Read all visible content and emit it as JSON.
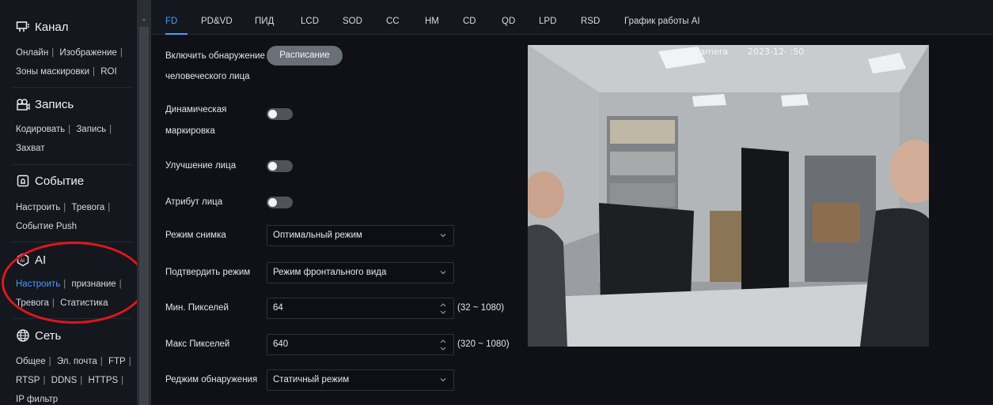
{
  "sidebar": {
    "channel": {
      "title": "Канал",
      "links": [
        "Онлайн",
        "Изображение",
        "Зоны маскировки",
        "ROI"
      ]
    },
    "record": {
      "title": "Запись",
      "links": [
        "Кодировать",
        "Запись",
        "Захват"
      ]
    },
    "event": {
      "title": "Событие",
      "links": [
        "Настроить",
        "Тревога",
        "Событие Push"
      ]
    },
    "ai": {
      "title": "AI",
      "links": [
        "Настроить",
        "признание",
        "Тревога",
        "Статистика"
      ],
      "active_link": "Настроить"
    },
    "network": {
      "title": "Сеть",
      "links": [
        "Общее",
        "Эл. почта",
        "FTP",
        "RTSP",
        "DDNS",
        "HTTPS",
        "IP фильтр"
      ]
    }
  },
  "tabs": [
    "FD",
    "PD&VD",
    "ПИД",
    "LCD",
    "SOD",
    "CC",
    "HM",
    "CD",
    "QD",
    "LPD",
    "RSD",
    "График работы AI"
  ],
  "active_tab": "FD",
  "form": {
    "enable_label_line1": "Включить обнаружение",
    "enable_label_line2": "человеческого лица",
    "schedule_button": "Расписание",
    "dynamic_marking_line1": "Динамическая",
    "dynamic_marking_line2": "маркировка",
    "dynamic_marking_on": false,
    "face_enhance": "Улучшение лица",
    "face_enhance_on": false,
    "face_attribute": "Атрибут лица",
    "face_attribute_on": false,
    "snap_mode_label": "Режим снимка",
    "snap_mode_value": "Оптимальный режим",
    "confirm_mode_label": "Подтвердить режим",
    "confirm_mode_value": "Режим фронтального вида",
    "min_pixels_label": "Мин. Пикселей",
    "min_pixels_value": "64",
    "min_pixels_range": "(32 ~ 1080)",
    "max_pixels_label": "Макс Пикселей",
    "max_pixels_value": "640",
    "max_pixels_range": "(320 ~ 1080)",
    "detect_mode_label": "Реджим обнаружения",
    "detect_mode_value": "Статичный режим"
  },
  "preview": {
    "osd_name": "Camera",
    "osd_time": "2023-12-  :50"
  },
  "colors": {
    "accent": "#4a9bff",
    "annotation_ring": "#e0151e",
    "background": "#0f1116"
  }
}
